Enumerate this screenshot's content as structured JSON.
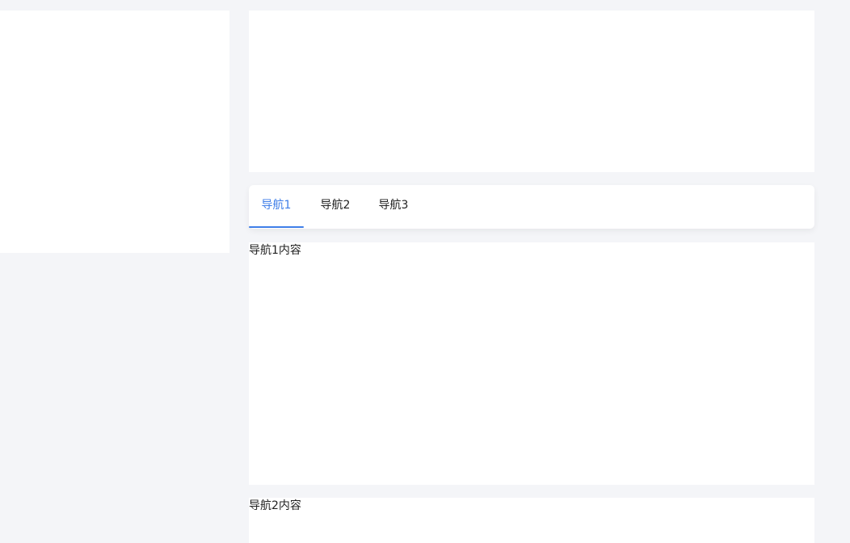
{
  "tabs": [
    {
      "label": "导航1",
      "active": true
    },
    {
      "label": "导航2",
      "active": false
    },
    {
      "label": "导航3",
      "active": false
    }
  ],
  "sections": [
    {
      "text": "导航1内容"
    },
    {
      "text": "导航2内容"
    }
  ],
  "colors": {
    "page_background": "#f4f5f8",
    "panel_background": "#ffffff",
    "active_tab": "#3f7ee8",
    "text": "#222222"
  }
}
